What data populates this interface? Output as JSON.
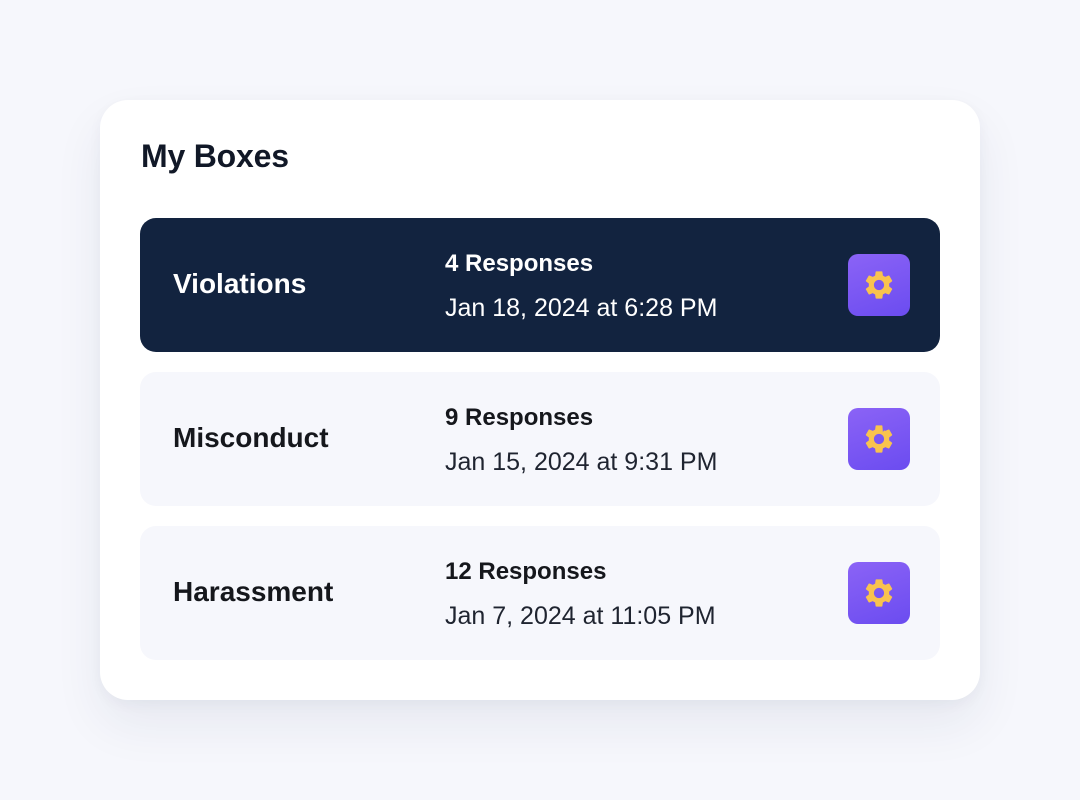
{
  "title": "My Boxes",
  "colors": {
    "page_background": "#f6f7fc",
    "card_background": "#ffffff",
    "active_row": "#12233f",
    "row_background": "#f6f7fc",
    "button_gradient": [
      "#8b63f6",
      "#6b4cf0"
    ],
    "gear_icon": "#f9c34e"
  },
  "boxes": [
    {
      "name": "Violations",
      "responses": "4 Responses",
      "date": "Jan 18, 2024 at 6:28 PM",
      "active": true,
      "icon": "gear-icon"
    },
    {
      "name": "Misconduct",
      "responses": "9 Responses",
      "date": "Jan 15, 2024 at 9:31 PM",
      "active": false,
      "icon": "gear-icon"
    },
    {
      "name": "Harassment",
      "responses": "12 Responses",
      "date": "Jan 7, 2024 at 11:05 PM",
      "active": false,
      "icon": "gear-icon"
    }
  ]
}
